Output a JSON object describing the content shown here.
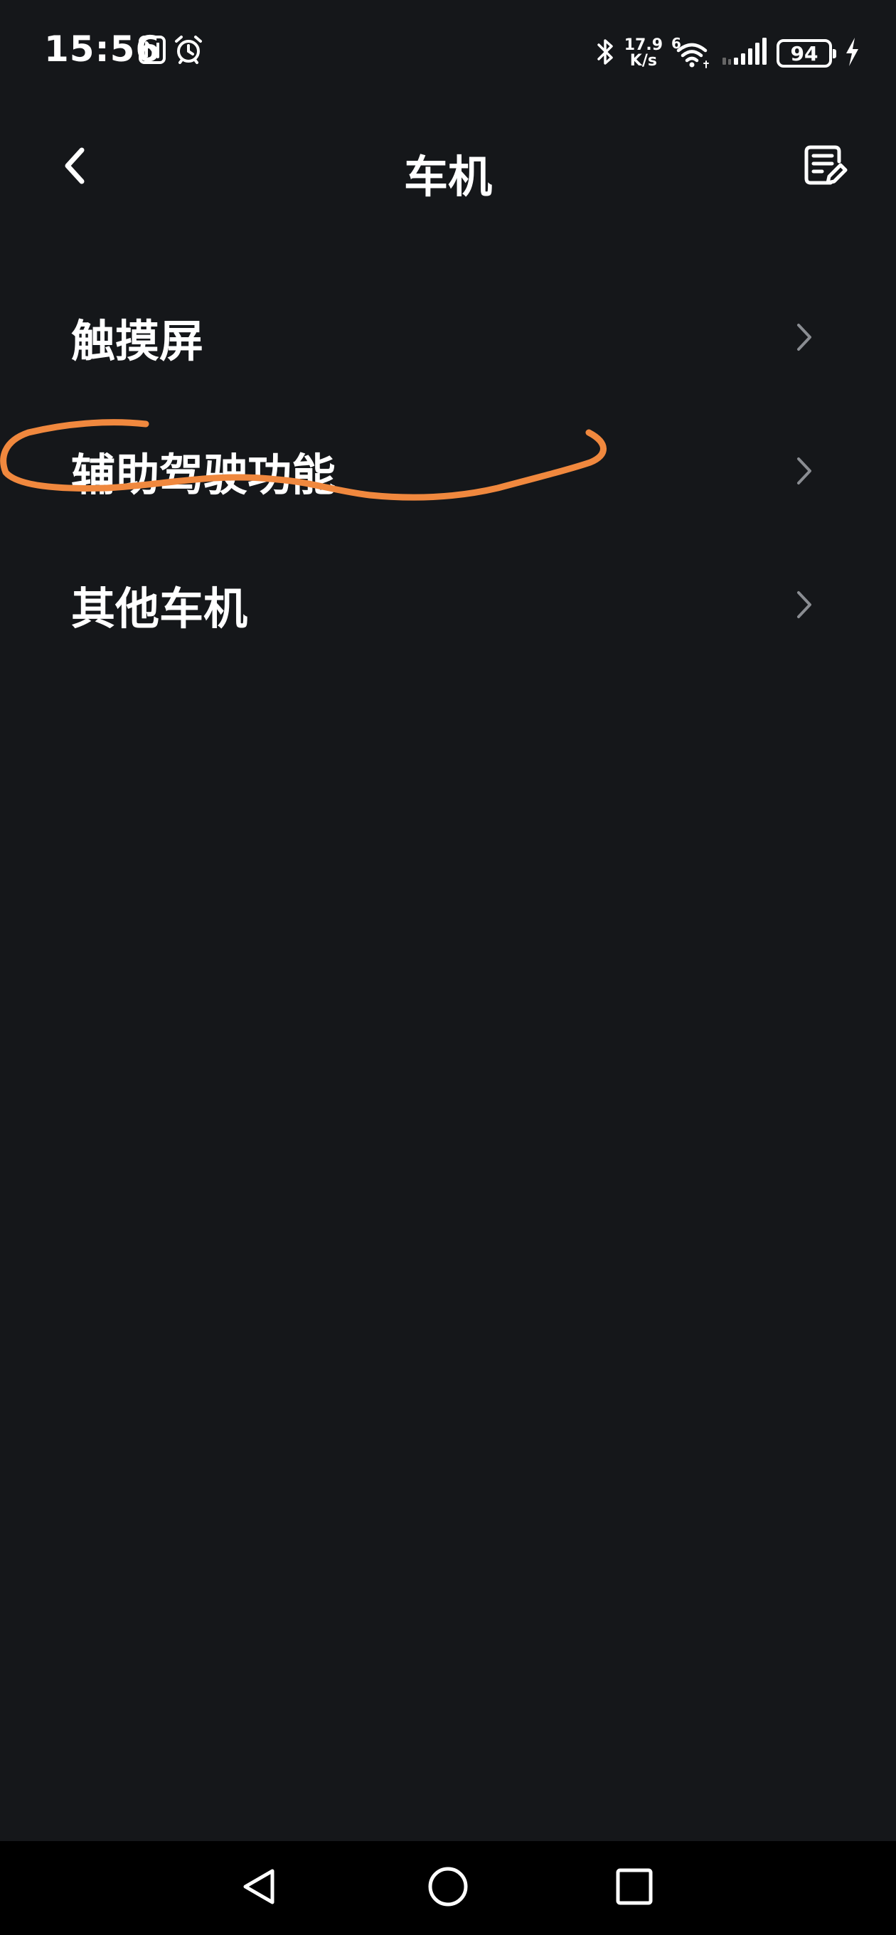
{
  "status_bar": {
    "time": "15:56",
    "net_speed_value": "17.9",
    "net_speed_unit": "K/s",
    "wifi_label": "6",
    "battery_level": "94"
  },
  "header": {
    "title": "车机"
  },
  "menu": {
    "items": [
      {
        "label": "触摸屏"
      },
      {
        "label": "辅助驾驶功能"
      },
      {
        "label": "其他车机"
      }
    ]
  },
  "colors": {
    "background": "#15171a",
    "annotation": "#f0883e",
    "text": "#ffffff",
    "chevron": "#8a8d92"
  },
  "icons": {
    "back": "chevron-left-icon",
    "feedback": "edit-document-icon",
    "nfc": "nfc-icon",
    "alarm": "alarm-icon",
    "bluetooth": "bluetooth-icon",
    "wifi": "wifi-icon",
    "signal": "signal-icon",
    "charging": "charging-bolt-icon"
  }
}
